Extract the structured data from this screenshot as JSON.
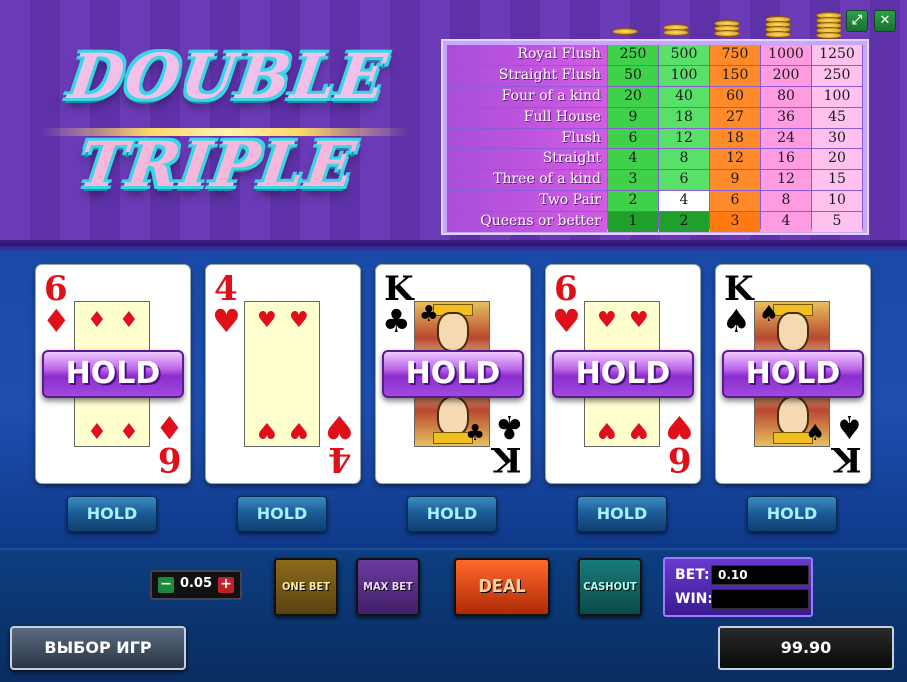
{
  "logo": {
    "line1": "DOUBLE",
    "line2": "TRIPLE"
  },
  "window": {
    "expand_glyph": "⤢",
    "close_glyph": "✕"
  },
  "paytable": {
    "hands": [
      "Royal Flush",
      "Straight Flush",
      "Four of a kind",
      "Full House",
      "Flush",
      "Straight",
      "Three of a kind",
      "Two Pair",
      "Queens or better"
    ],
    "payouts": [
      [
        250,
        500,
        750,
        1000,
        1250
      ],
      [
        50,
        100,
        150,
        200,
        250
      ],
      [
        20,
        40,
        60,
        80,
        100
      ],
      [
        9,
        18,
        27,
        36,
        45
      ],
      [
        6,
        12,
        18,
        24,
        30
      ],
      [
        4,
        8,
        12,
        16,
        20
      ],
      [
        3,
        6,
        9,
        12,
        15
      ],
      [
        2,
        4,
        6,
        8,
        10
      ],
      [
        1,
        2,
        3,
        4,
        5
      ]
    ],
    "coin_stacks": [
      1,
      2,
      3,
      4,
      5
    ]
  },
  "cards": [
    {
      "rank": "6",
      "suit": "♦",
      "color": "red",
      "held": true
    },
    {
      "rank": "4",
      "suit": "♥",
      "color": "red",
      "held": false
    },
    {
      "rank": "K",
      "suit": "♣",
      "color": "black",
      "held": true
    },
    {
      "rank": "6",
      "suit": "♥",
      "color": "red",
      "held": true
    },
    {
      "rank": "K",
      "suit": "♠",
      "color": "black",
      "held": true
    }
  ],
  "hold_overlay_label": "HOLD",
  "hold_button_label": "HOLD",
  "denomination": {
    "value": "0.05",
    "minus": "−",
    "plus": "+"
  },
  "buttons": {
    "one_bet": "ONE BET",
    "max_bet": "MAX BET",
    "deal": "DEAL",
    "cashout": "CASHOUT",
    "game_select": "ВЫБОР ИГР"
  },
  "bet_panel": {
    "bet_label": "BET:",
    "bet_value": "0.10",
    "win_label": "WIN:",
    "win_value": ""
  },
  "balance": "99.90",
  "colors": {
    "paytable_hand": "#c94fe0",
    "col1": "#3fd14a",
    "col2": "#58e068",
    "col3": "#ff8a2a",
    "col4": "#ff9be0",
    "col5": "#ffc2ee"
  }
}
